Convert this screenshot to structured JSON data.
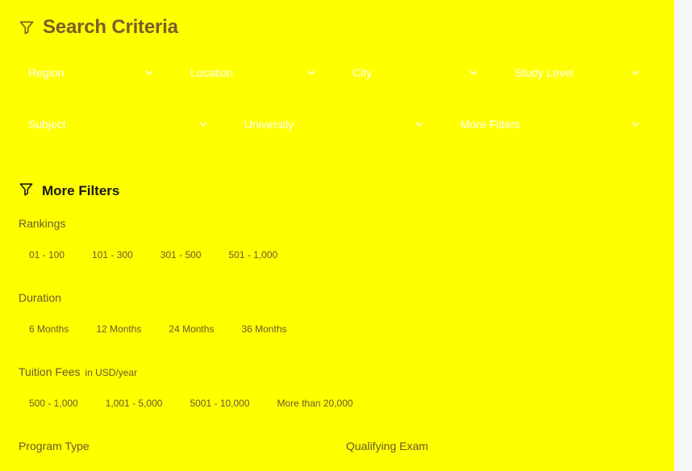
{
  "header": {
    "title": "Search Criteria",
    "icon": "filter-icon"
  },
  "filters_row1": [
    {
      "label": "Region"
    },
    {
      "label": "Location"
    },
    {
      "label": "City"
    },
    {
      "label": "Study Level"
    }
  ],
  "filters_row2": [
    {
      "label": "Subject"
    },
    {
      "label": "University"
    },
    {
      "label": "More Filters"
    }
  ],
  "more_filters": {
    "title": "More Filters",
    "icon": "filter-icon",
    "rankings": {
      "label": "Rankings",
      "options": [
        "01 - 100",
        "101 - 300",
        "301 - 500",
        "501 - 1,000"
      ]
    },
    "duration": {
      "label": "Duration",
      "options": [
        "6 Months",
        "12 Months",
        "24 Months",
        "36 Months"
      ]
    },
    "tuition": {
      "label": "Tuition Fees",
      "unit": "in USD/year",
      "options": [
        "500 - 1,000",
        "1,001 - 5,000",
        "5001 - 10,000",
        "More than 20,000"
      ]
    },
    "program_type": {
      "label": "Program Type"
    },
    "qualifying_exam": {
      "label": "Qualifying Exam"
    }
  },
  "colors": {
    "panel_bg": "#ffff00",
    "heading": "#7a5f2a",
    "dropdown_text": "#ffffff"
  }
}
